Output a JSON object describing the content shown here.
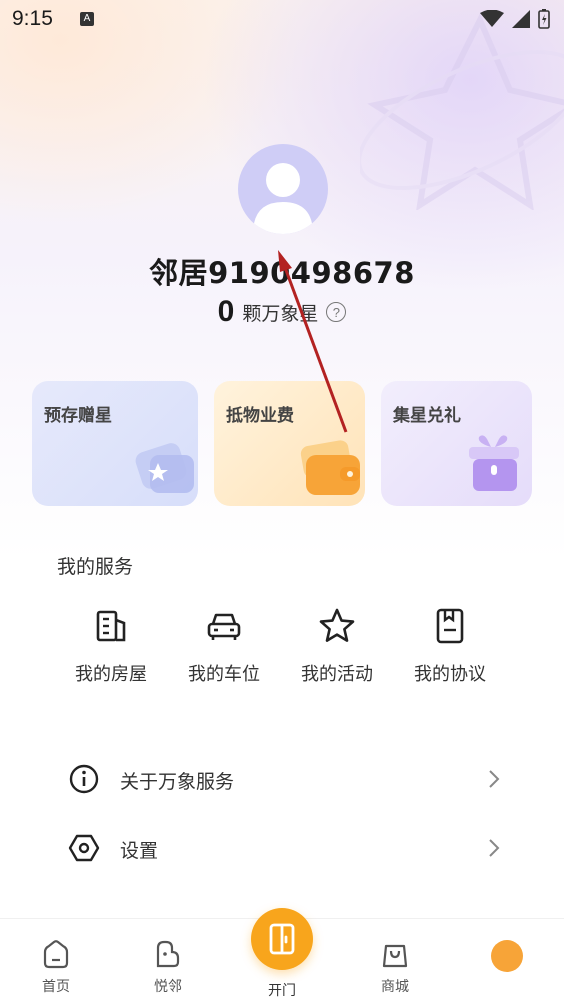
{
  "status_bar": {
    "time": "9:15",
    "notif_letter": "A"
  },
  "profile": {
    "username": "邻居9190498678",
    "stars_count": "0",
    "stars_label": "颗万象星",
    "help_symbol": "?"
  },
  "cards": [
    {
      "title": "预存赠星",
      "icon": "wallet-star-icon",
      "color": "#d7defa"
    },
    {
      "title": "抵物业费",
      "icon": "wallet-icon",
      "color": "#ffe3b8"
    },
    {
      "title": "集星兑礼",
      "icon": "gift-icon",
      "color": "#e5dcfa"
    }
  ],
  "services": {
    "title": "我的服务",
    "items": [
      {
        "label": "我的房屋",
        "icon": "building-icon"
      },
      {
        "label": "我的车位",
        "icon": "car-icon"
      },
      {
        "label": "我的活动",
        "icon": "star-icon"
      },
      {
        "label": "我的协议",
        "icon": "document-icon"
      }
    ]
  },
  "menu": [
    {
      "label": "关于万象服务",
      "icon": "info-icon"
    },
    {
      "label": "设置",
      "icon": "settings-hex-icon"
    }
  ],
  "tabbar": {
    "home": "首页",
    "neighbors": "悦邻",
    "open": "开门",
    "mall": "商城",
    "accent": "#f8a51c"
  }
}
